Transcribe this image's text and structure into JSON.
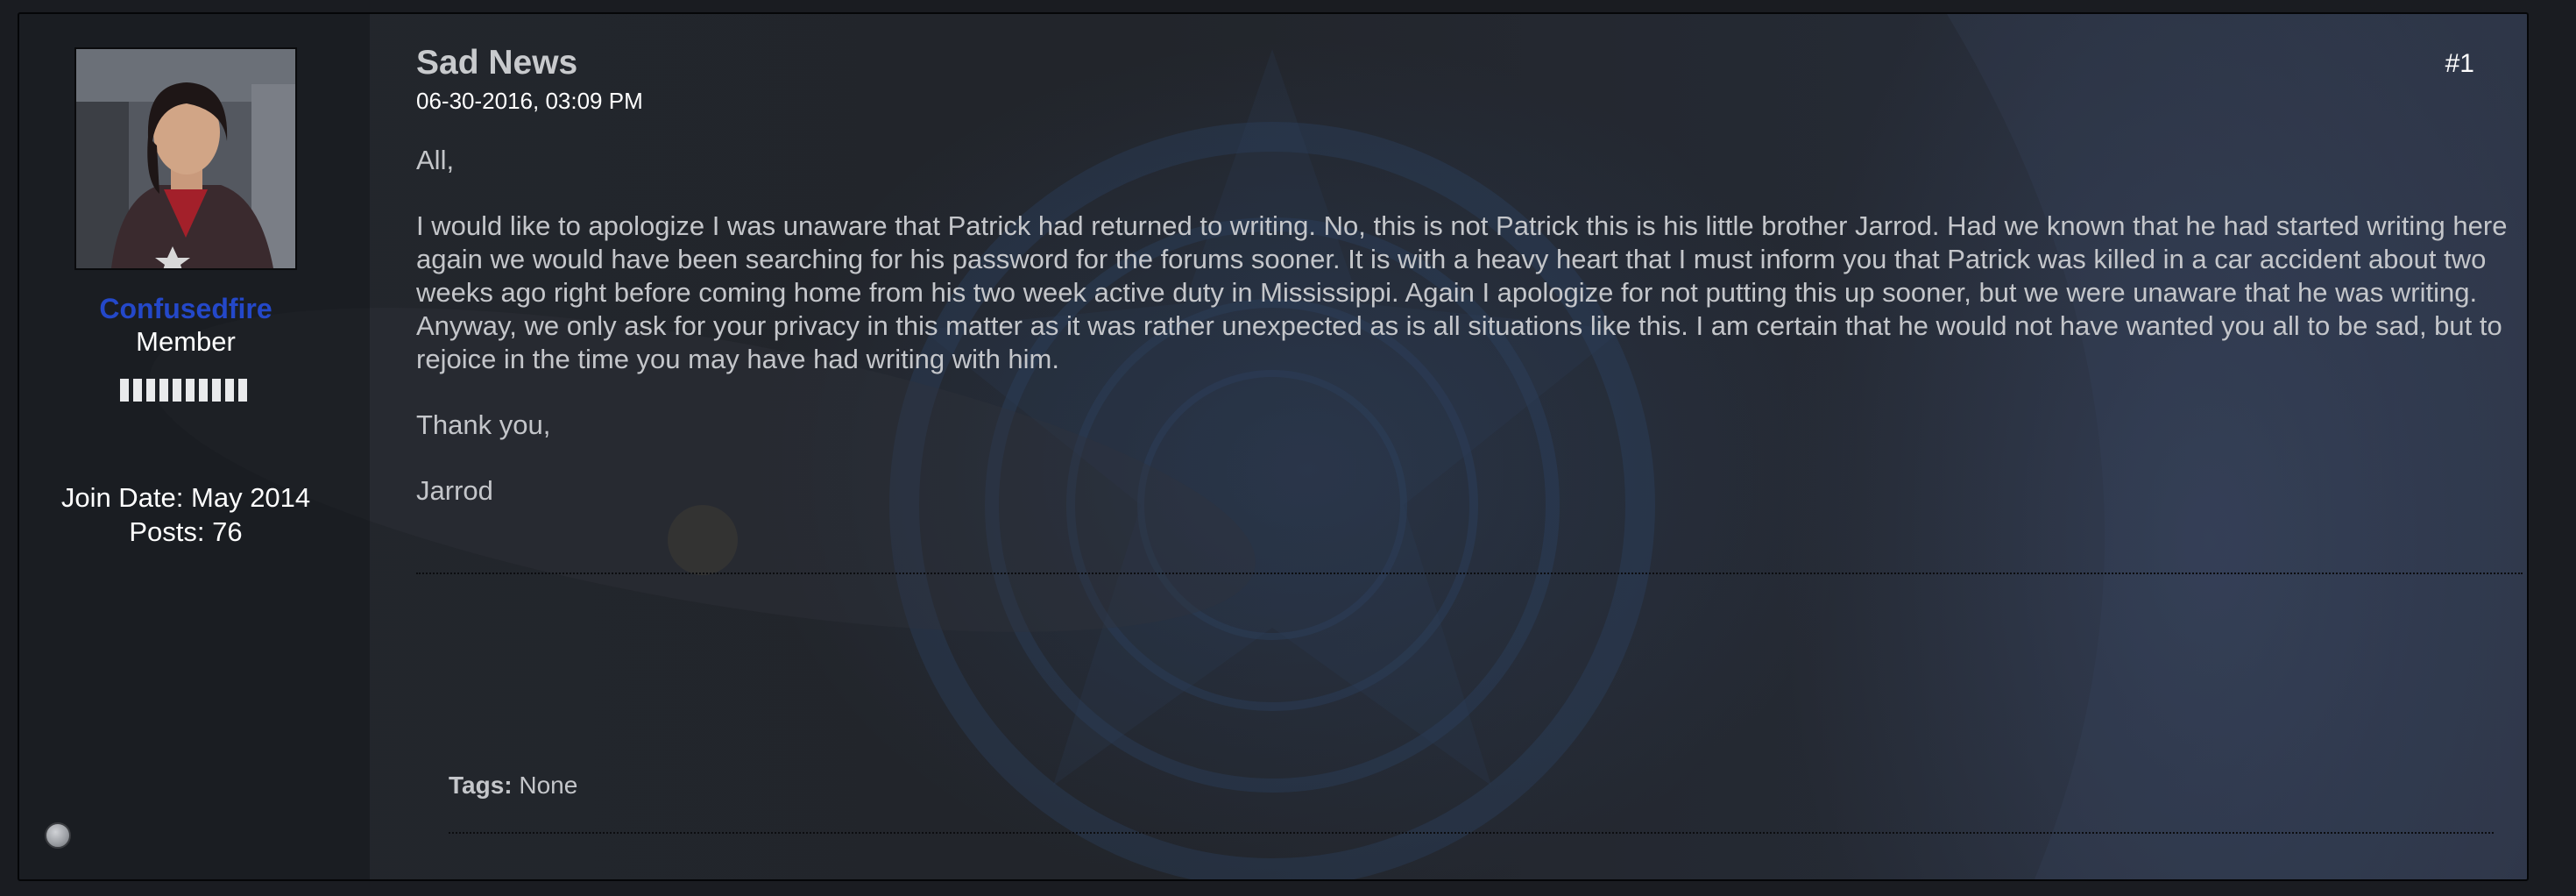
{
  "author": {
    "username": "Confusedfire",
    "title": "Member",
    "reputation_segments": 10,
    "join_date": "Join Date: May 2014",
    "posts": "Posts: 76"
  },
  "post": {
    "title": "Sad News",
    "date": "06-30-2016, 03:09 PM",
    "number": "#1",
    "paragraphs": [
      "All,",
      "I would like to apologize I was unaware that Patrick had returned to writing. No, this is not Patrick this is his little brother Jarrod. Had we known that he had started writing here again we would have been searching for his password for the forums sooner. It is with a heavy heart that I must inform you that Patrick was killed in a car accident about two weeks ago right before coming home from his two week active duty in Mississippi. Again I apologize for not putting this up sooner, but we were unaware that he was writing. Anyway, we only ask for your privacy in this matter as it was rather unexpected as is all situations like this. I am certain that he would not have wanted you all to be sad, but to rejoice in the time you may have had writing with him.",
      "Thank you,",
      "Jarrod"
    ]
  },
  "tags": {
    "label": "Tags:",
    "value": "None"
  },
  "colors": {
    "username": "#2448c9",
    "background": "#23262c"
  }
}
